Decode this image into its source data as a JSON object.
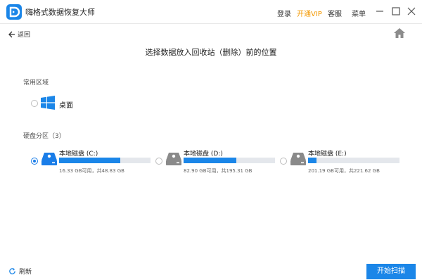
{
  "app": {
    "title": "嗨格式数据恢复大师"
  },
  "titlebar": {
    "login": "登录",
    "vip": "开通VIP",
    "service": "客服",
    "menu": "菜单"
  },
  "nav": {
    "back_label": "返回"
  },
  "heading": "选择数据放入回收站（删除）前的位置",
  "common_section": {
    "label": "常用区域",
    "items": [
      {
        "label": "桌面",
        "selected": false
      }
    ]
  },
  "disk_section": {
    "label": "硬盘分区（3）",
    "drives": [
      {
        "name": "本地磁盘 (C:)",
        "info": "16.33 GB可用，共48.83 GB",
        "used_fraction": 0.666,
        "selected": true
      },
      {
        "name": "本地磁盘 (D:)",
        "info": "82.90 GB可用，共195.31 GB",
        "used_fraction": 0.576,
        "selected": false
      },
      {
        "name": "本地磁盘 (E:)",
        "info": "201.19 GB可用，共221.62 GB",
        "used_fraction": 0.092,
        "selected": false
      }
    ]
  },
  "footer": {
    "refresh_label": "刷新",
    "start_label": "开始扫描"
  },
  "colors": {
    "accent": "#1b86e8",
    "vip": "#f39800",
    "drive_selected": "#1a7de8",
    "drive_unselected": "#8a8a8a"
  },
  "icons": {
    "app": "app-logo-icon",
    "back": "arrow-left-icon",
    "home": "home-icon",
    "desktop": "windows-logo-icon",
    "drive": "hard-drive-icon",
    "refresh": "refresh-icon"
  }
}
